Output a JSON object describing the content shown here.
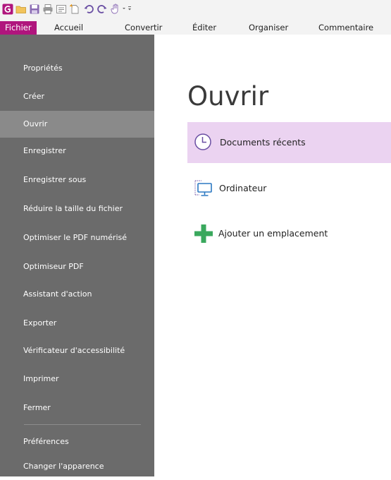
{
  "menu": {
    "tabs": [
      {
        "label": "Fichier"
      },
      {
        "label": "Accueil"
      },
      {
        "label": "Convertir"
      },
      {
        "label": "Éditer"
      },
      {
        "label": "Organiser"
      },
      {
        "label": "Commentaire"
      }
    ],
    "active_tab": "Fichier"
  },
  "sidebar": {
    "items": [
      {
        "label": "Propriétés"
      },
      {
        "label": "Créer"
      },
      {
        "label": "Ouvrir"
      },
      {
        "label": "Enregistrer"
      },
      {
        "label": "Enregistrer sous"
      },
      {
        "label": "Réduire la taille du fichier"
      },
      {
        "label": "Optimiser le PDF numérisé"
      },
      {
        "label": "Optimiseur PDF"
      },
      {
        "label": "Assistant d'action"
      },
      {
        "label": "Exporter"
      },
      {
        "label": "Vérificateur d'accessibilité"
      },
      {
        "label": "Imprimer"
      },
      {
        "label": "Fermer"
      },
      {
        "label": "Préférences"
      },
      {
        "label": "Changer l'apparence"
      }
    ],
    "selected_item": "Ouvrir"
  },
  "main": {
    "title": "Ouvrir",
    "options": [
      {
        "label": "Documents récents",
        "icon": "clock-icon"
      },
      {
        "label": "Ordinateur",
        "icon": "computer-icon"
      },
      {
        "label": "Ajouter un emplacement",
        "icon": "plus-icon"
      }
    ],
    "selected_option": "Documents récents"
  },
  "colors": {
    "accent": "#b0157d",
    "sidebar_bg": "#6b6b6b",
    "sidebar_selected": "#8a8a8a",
    "selected_row": "#ebd3f1",
    "plus_green": "#3aa85d"
  }
}
